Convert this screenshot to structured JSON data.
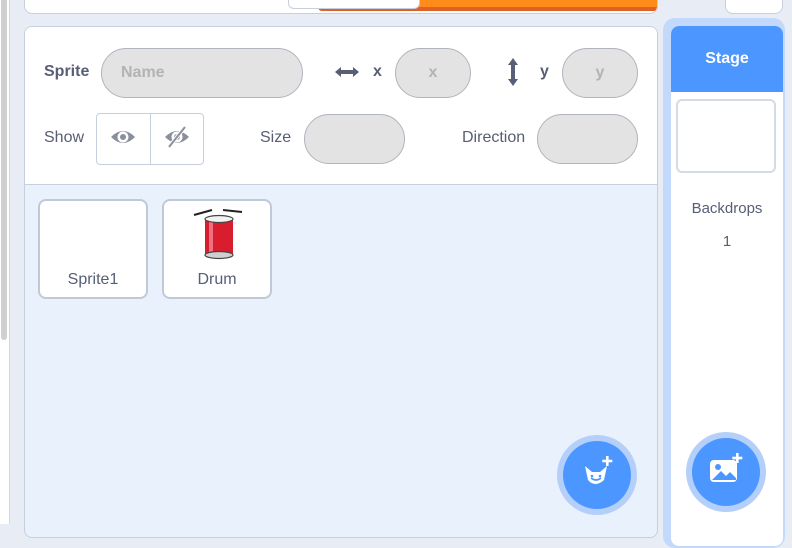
{
  "sprite_info": {
    "sprite_label": "Sprite",
    "name_placeholder": "Name",
    "x_label": "x",
    "x_placeholder": "x",
    "y_label": "y",
    "y_placeholder": "y",
    "show_label": "Show",
    "size_label": "Size",
    "direction_label": "Direction"
  },
  "sprites": [
    {
      "name": "Sprite1",
      "icon": "empty"
    },
    {
      "name": "Drum",
      "icon": "drum-icon"
    }
  ],
  "stage": {
    "header": "Stage",
    "backdrops_label": "Backdrops",
    "backdrops_count": "1"
  },
  "icons": {
    "add_sprite": "cat-plus-icon",
    "add_backdrop": "image-plus-icon",
    "visible": "eye-icon",
    "hidden": "eye-slash-icon",
    "x_axis": "horizontal-arrows-icon",
    "y_axis": "vertical-arrows-icon"
  },
  "colors": {
    "accent": "#4c97ff",
    "accent_light": "#b4d0fa",
    "pane_bg": "#e9f1fc",
    "text": "#575e75"
  }
}
